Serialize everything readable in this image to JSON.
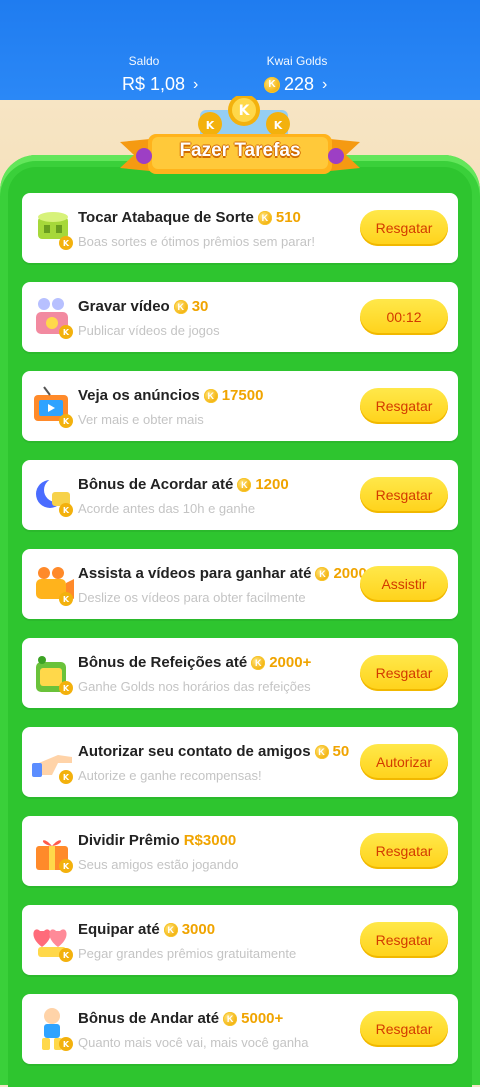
{
  "header": {
    "balance_label": "Saldo",
    "balance_value": "R$ 1,08",
    "golds_label": "Kwai Golds",
    "golds_value": "228",
    "chevron": "›"
  },
  "banner": {
    "title": "Fazer Tarefas"
  },
  "coin_glyph": "K",
  "tasks": [
    {
      "title": "Tocar Atabaque de Sorte",
      "reward": "510",
      "subtitle": "Boas sortes e ótimos prêmios sem parar!",
      "button": "Resgatar",
      "icon": "drum-icon"
    },
    {
      "title": "Gravar vídeo",
      "reward": "30",
      "subtitle": "Publicar vídeos de jogos",
      "button": "00:12",
      "icon": "video-camera-icon"
    },
    {
      "title": "Veja os anúncios",
      "reward": "17500",
      "subtitle": "Ver mais e obter mais",
      "button": "Resgatar",
      "icon": "tv-icon"
    },
    {
      "title": "Bônus de Acordar até",
      "reward": "1200",
      "subtitle": "Acorde antes das 10h e ganhe",
      "button": "Resgatar",
      "icon": "moon-icon"
    },
    {
      "title": "Assista a vídeos para ganhar até",
      "reward": "2000",
      "subtitle": "Deslize os vídeos para obter facilmente",
      "button": "Assistir",
      "icon": "movie-camera-icon"
    },
    {
      "title": "Bônus de Refeições até",
      "reward": "2000+",
      "subtitle": "Ganhe Golds nos horários das refeições",
      "button": "Resgatar",
      "icon": "meal-box-icon"
    },
    {
      "title": "Autorizar seu contato de amigos",
      "reward": "50",
      "subtitle": "Autorize e ganhe recompensas!",
      "button": "Autorizar",
      "icon": "pointing-hand-icon"
    },
    {
      "title": "Dividir Prêmio",
      "reward": "R$3000",
      "subtitle": "Seus amigos estão jogando",
      "button": "Resgatar",
      "icon": "gift-box-icon"
    },
    {
      "title": "Equipar até",
      "reward": "3000",
      "subtitle": "Pegar grandes prêmios gratuitamente",
      "button": "Resgatar",
      "icon": "hearts-icon"
    },
    {
      "title": "Bônus de Andar até",
      "reward": "5000+",
      "subtitle": "Quanto mais você vai, mais você ganha",
      "button": "Resgatar",
      "icon": "walking-boy-icon"
    }
  ],
  "colors": {
    "header_blue": "#1f7cf0",
    "board_green": "#2ec52f",
    "button_yellow": "#ffd21a",
    "button_text": "#d33a00",
    "reward_gold": "#f0a400"
  }
}
